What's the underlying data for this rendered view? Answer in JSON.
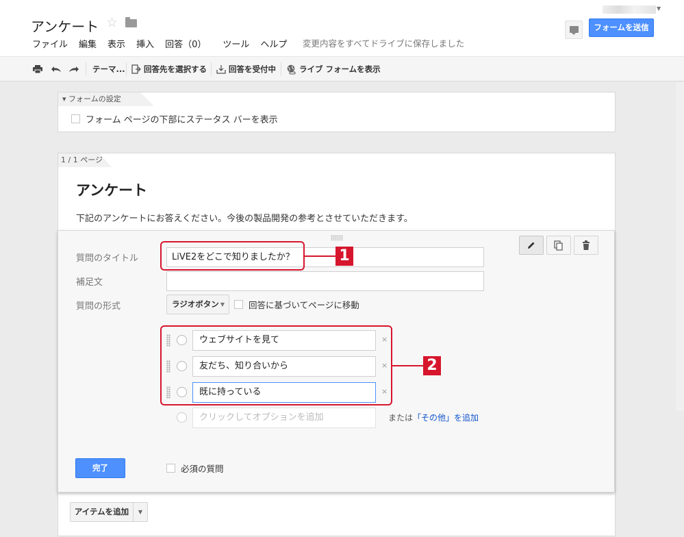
{
  "header": {
    "title": "アンケート",
    "menus": [
      "ファイル",
      "編集",
      "表示",
      "挿入",
      "回答（0）",
      "ツール",
      "ヘルプ"
    ],
    "save_status": "変更内容をすべてドライブに保存しました",
    "send_button": "フォームを送信"
  },
  "toolbar": {
    "print_icon": "⎙",
    "undo_icon": "↶",
    "redo_icon": "↷",
    "theme": "テーマ...",
    "select_destination": "回答先を選択する",
    "accepting": "回答を受付中",
    "view_live": "ライブ フォームを表示"
  },
  "settings": {
    "tab_label": "▾ フォームの設定",
    "status_bar_label": "フォーム ページの下部にステータス バーを表示"
  },
  "page": {
    "tab_label": "1 / 1 ページ",
    "form_title": "アンケート",
    "form_description": "下記のアンケートにお答えください。今後の製品開発の参考とさせていただきます。"
  },
  "question": {
    "title_label": "質問のタイトル",
    "title_value": "LiVE2をどこで知りましたか？",
    "help_label": "補足文",
    "help_value": "",
    "type_label": "質問の形式",
    "type_value": "ラジオボタン",
    "goto_label": "回答に基づいてページに移動",
    "options": [
      "ウェブサイトを見て",
      "友だち、知り合いから",
      "既に持っている"
    ],
    "add_option_placeholder": "クリックしてオプションを追加",
    "or_text": "または",
    "other_link": "「その他」を追加",
    "done_button": "完了",
    "required_label": "必須の質問",
    "delete_option": "×"
  },
  "annotations": [
    "1",
    "2"
  ],
  "add_item": {
    "label": "アイテムを追加"
  },
  "colors": {
    "accent_blue": "#4d90fe",
    "annotation_red": "#d6162c",
    "link": "#1155cc"
  }
}
